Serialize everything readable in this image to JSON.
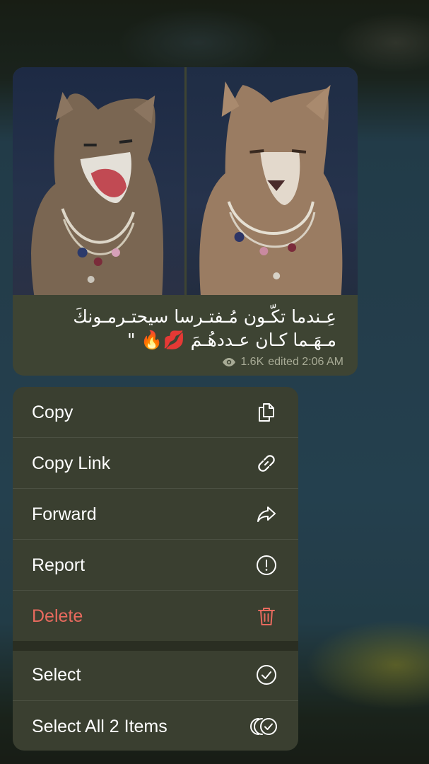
{
  "message": {
    "caption_line1": "عِـندما تكّـون مُـفتـرسا سيحتـرمـونكَ",
    "caption_line2": "مـهَـما كـان عـددهُـمَ 💋🔥 \"",
    "views": "1.6K",
    "edited_time": "edited 2:06 AM",
    "photo_left": "snarling cougar with jeweled necklace",
    "photo_right": "calm cougar with pearl necklace"
  },
  "menu": {
    "copy": "Copy",
    "copy_link": "Copy Link",
    "forward": "Forward",
    "report": "Report",
    "delete": "Delete",
    "select": "Select",
    "select_all": "Select All 2 Items"
  },
  "colors": {
    "bubble": "#3e4433",
    "menu": "#3a3f30",
    "danger": "#e86a5e"
  }
}
